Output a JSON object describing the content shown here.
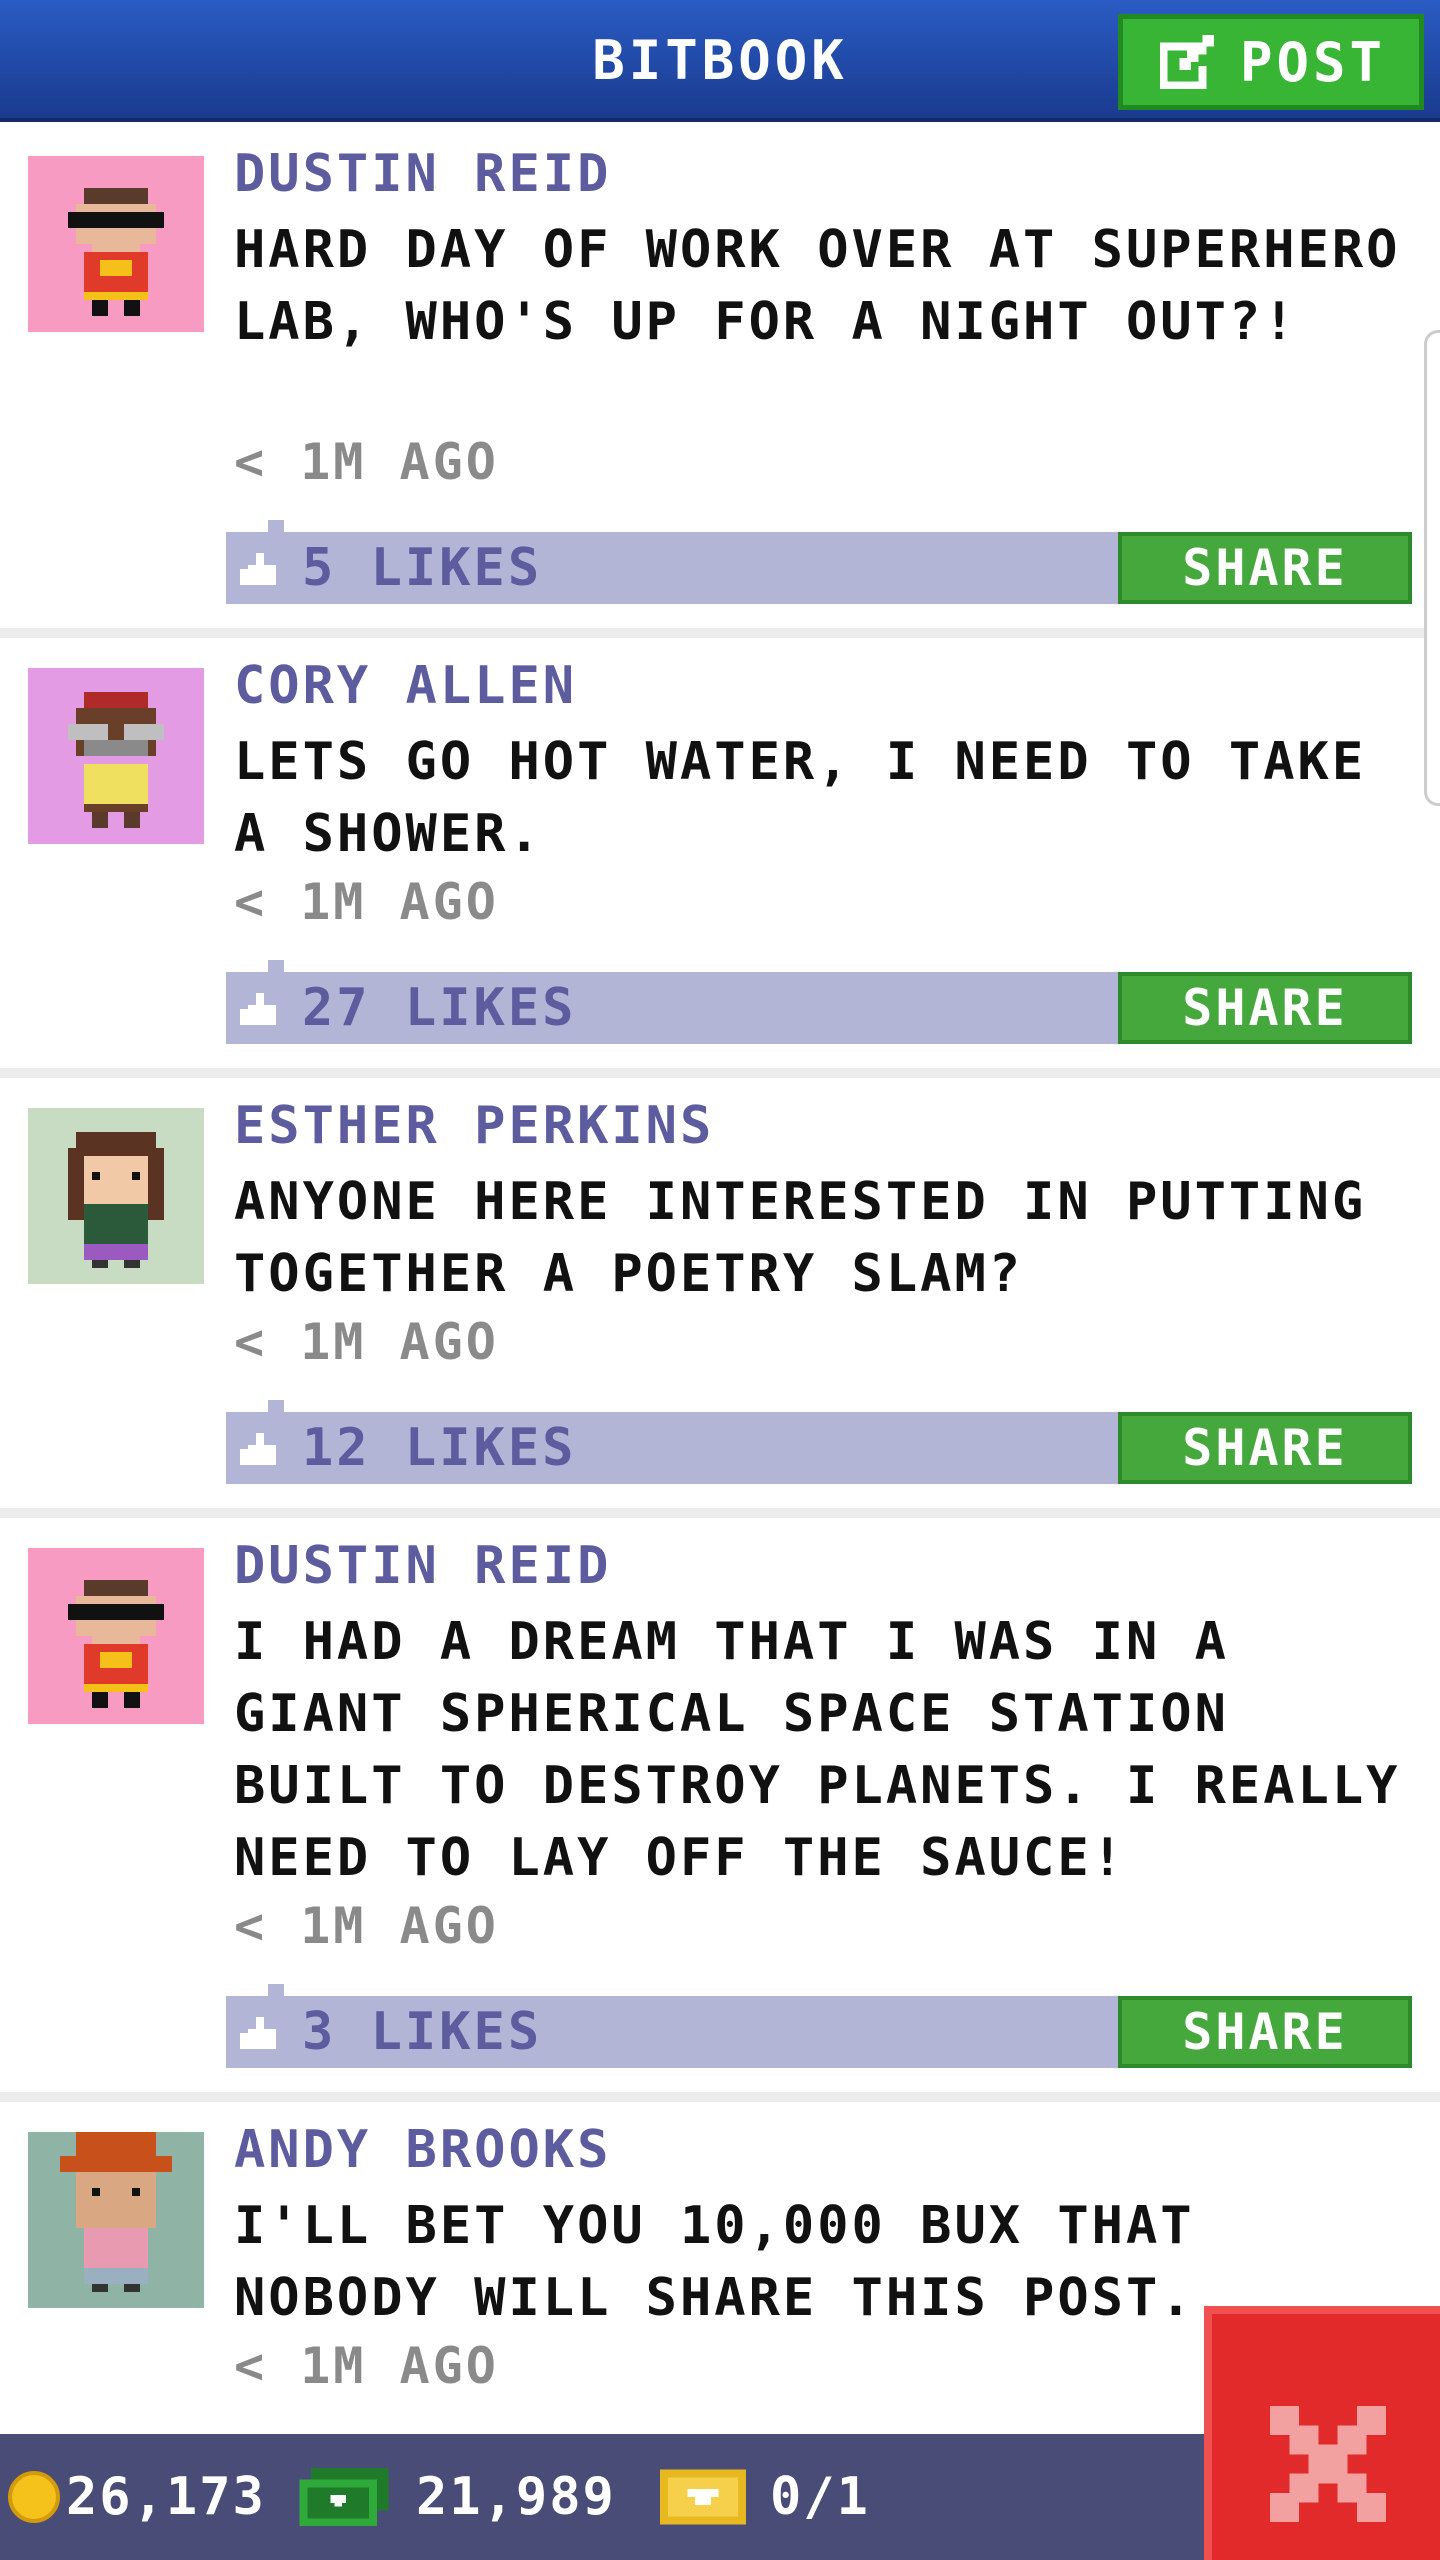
{
  "header": {
    "title": "BITBOOK",
    "post_label": "POST"
  },
  "posts": [
    {
      "author": "DUSTIN REID",
      "text": "HARD DAY OF WORK OVER AT SUPERHERO LAB, WHO'S UP FOR A NIGHT OUT?!",
      "time": "< 1M AGO",
      "likes": "5 LIKES",
      "share_label": "SHARE",
      "avatar_bg": "#f79bc3"
    },
    {
      "author": "CORY ALLEN",
      "text": "LETS GO HOT WATER, I NEED TO TAKE A SHOWER.",
      "time": "< 1M AGO",
      "likes": "27 LIKES",
      "share_label": "SHARE",
      "avatar_bg": "#e39be3"
    },
    {
      "author": "ESTHER PERKINS",
      "text": "ANYONE HERE INTERESTED IN PUTTING TOGETHER A POETRY SLAM?",
      "time": "< 1M AGO",
      "likes": "12 LIKES",
      "share_label": "SHARE",
      "avatar_bg": "#c8dcc4"
    },
    {
      "author": "DUSTIN REID",
      "text": "I HAD A DREAM THAT I WAS IN A GIANT SPHERICAL SPACE STATION BUILT TO DESTROY PLANETS. I REALLY NEED TO LAY OFF THE SAUCE!",
      "time": "< 1M AGO",
      "likes": "3 LIKES",
      "share_label": "SHARE",
      "avatar_bg": "#f79bc3"
    },
    {
      "author": "ANDY BROOKS",
      "text": "I'LL BET YOU 10,000 BUX THAT NOBODY WILL SHARE THIS POST.",
      "time": "< 1M AGO",
      "avatar_bg": "#8fb3a4"
    }
  ],
  "status": {
    "coins": "26,173",
    "bux": "21,989",
    "tickets": "0/1"
  },
  "colors": {
    "header": "#1f47a8",
    "accent_green": "#44a83c",
    "like_bar": "#b3b5d7",
    "author_text": "#5c5c9e",
    "close_red": "#e22a2a"
  },
  "icons": {
    "post": "edit-icon",
    "like": "thumbs-up-icon",
    "close": "close-icon",
    "coin": "coin-icon",
    "bux": "bux-icon",
    "ticket": "ticket-icon"
  }
}
